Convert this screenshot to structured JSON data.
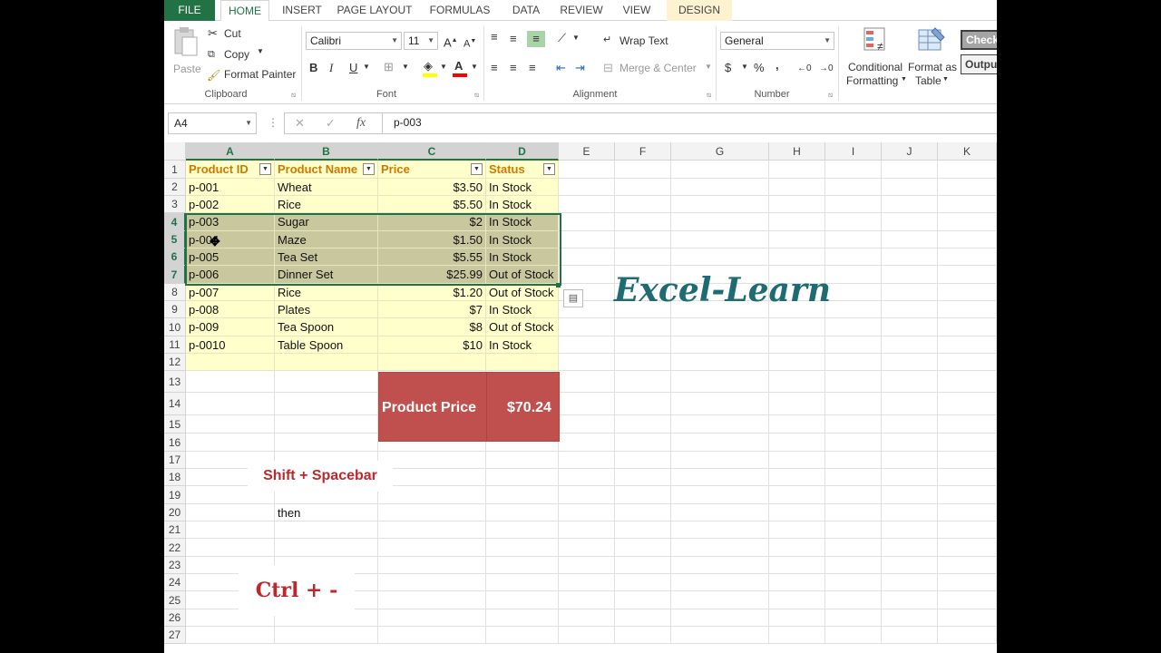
{
  "ribbon_tabs": [
    "FILE",
    "HOME",
    "INSERT",
    "PAGE LAYOUT",
    "FORMULAS",
    "DATA",
    "REVIEW",
    "VIEW",
    "DESIGN"
  ],
  "clipboard": {
    "paste": "Paste",
    "cut": "Cut",
    "copy": "Copy",
    "format_painter": "Format Painter",
    "title": "Clipboard"
  },
  "font": {
    "name": "Calibri",
    "size": "11",
    "bold": "B",
    "italic": "I",
    "underline": "U",
    "title": "Font"
  },
  "alignment": {
    "wrap_text": "Wrap Text",
    "merge_center": "Merge & Center",
    "title": "Alignment"
  },
  "number": {
    "format": "General",
    "currency": "$",
    "percent": "%",
    "comma": ",",
    "title": "Number"
  },
  "styles": {
    "conditional_1": "Conditional",
    "conditional_2": "Formatting",
    "format_table_1": "Format as",
    "format_table_2": "Table",
    "check": "Check",
    "output": "Outpu"
  },
  "formula_bar": {
    "name_box": "A4",
    "cancel": "✕",
    "enter": "✓",
    "fx": "fx",
    "value": "p-003"
  },
  "columns": [
    "A",
    "B",
    "C",
    "D",
    "E",
    "F",
    "G",
    "H",
    "I",
    "J",
    "K"
  ],
  "rows": [
    "1",
    "2",
    "3",
    "4",
    "5",
    "6",
    "7",
    "8",
    "9",
    "10",
    "11",
    "12",
    "13",
    "14",
    "15",
    "16",
    "17",
    "18",
    "19",
    "20",
    "21",
    "22",
    "23",
    "24",
    "25",
    "26",
    "27"
  ],
  "table": {
    "headers": [
      "Product ID",
      "Product Name",
      "Price",
      "Status"
    ],
    "rows": [
      [
        "p-001",
        "Wheat",
        "$3.50",
        "In Stock"
      ],
      [
        "p-002",
        "Rice",
        "$5.50",
        "In Stock"
      ],
      [
        "p-003",
        "Sugar",
        "$2",
        "In Stock"
      ],
      [
        "p-004",
        "Maze",
        "$1.50",
        "In Stock"
      ],
      [
        "p-005",
        "Tea Set",
        "$5.55",
        "In Stock"
      ],
      [
        "p-006",
        "Dinner Set",
        "$25.99",
        "Out of Stock"
      ],
      [
        "p-007",
        "Rice",
        "$1.20",
        "Out of Stock"
      ],
      [
        "p-008",
        "Plates",
        "$7",
        "In Stock"
      ],
      [
        "p-009",
        "Tea Spoon",
        "$8",
        "Out of Stock"
      ],
      [
        "p-0010",
        "Table Spoon",
        "$10",
        "In Stock"
      ]
    ]
  },
  "summary": {
    "label": "Product Price",
    "value": "$70.24"
  },
  "notes": {
    "shift_space": "Shift + Spacebar",
    "then": "then",
    "ctrl_minus": "Ctrl + -"
  },
  "logo": "Excel-Learn",
  "colors": {
    "excel_green": "#217346",
    "table_fill": "#ffffcc",
    "selected_fill": "#c9c79e",
    "summary_red": "#c0504d",
    "header_orange": "#cc7a00"
  }
}
